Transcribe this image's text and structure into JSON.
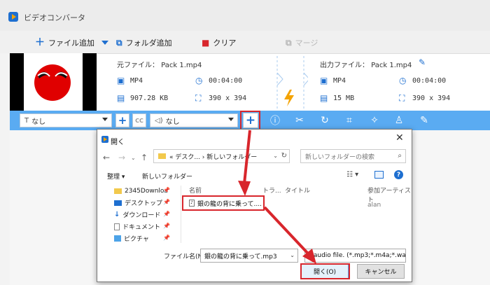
{
  "app": {
    "title": "ビデオコンバータ",
    "toolbar": {
      "add_file": "ファイル追加",
      "add_folder": "フォルダ追加",
      "clear": "クリア",
      "merge": "マージ"
    }
  },
  "task": {
    "source_label": "元ファイル： Pack 1.mp4",
    "output_label": "出力ファイル： Pack 1.mp4",
    "source": {
      "format": "MP4",
      "duration": "00:04:00",
      "size": "907.28 KB",
      "resolution": "390 x 394"
    },
    "output": {
      "format": "MP4",
      "duration": "00:04:00",
      "size": "15 MB",
      "resolution": "390 x 394"
    }
  },
  "edit_bar": {
    "subtitle_value": "なし",
    "audio_value": "なし",
    "add_symbol": "+",
    "cc_symbol": "CC",
    "icons": [
      "info-icon",
      "cut-icon",
      "rotate-icon",
      "crop-icon",
      "effect-icon",
      "watermark-icon",
      "edit-icon"
    ]
  },
  "dialog": {
    "title": "開く",
    "close_symbol": "✕",
    "address": "«  デスク... › 新しいフォルダー",
    "search_placeholder": "新しいフォルダーの検索",
    "organize": "整理 ▾",
    "new_folder": "新しいフォルダー",
    "nav_items": [
      "2345Downloa",
      "デスクトップ",
      "ダウンロード",
      "ドキュメント",
      "ピクチャ"
    ],
    "columns": [
      "名前",
      "トラ...",
      "タイトル",
      "参加アーティスト"
    ],
    "file_name": "銀の龍の背に乗って....",
    "file_artist": "alan",
    "filename_label": "ファイル名(N):",
    "filename_value": "銀の龍の背に乗って.mp3",
    "filetype_value": "ll audio file. (*.mp3;*.m4a;*.wa",
    "open_button": "開く(O)",
    "cancel_button": "キャンセル"
  },
  "colors": {
    "accent": "#1e6fd0",
    "bar": "#5aabf2",
    "highlight": "#d8262c"
  }
}
